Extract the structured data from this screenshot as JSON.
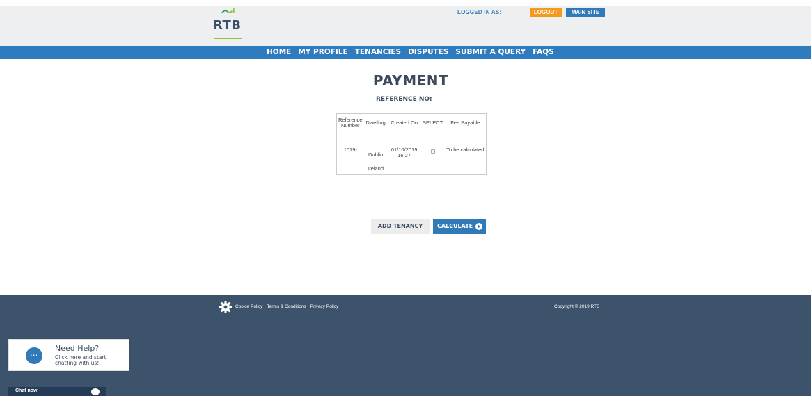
{
  "header": {
    "logo_text": "RTB",
    "logged_in_label": "LOGGED IN AS:",
    "logout_label": "LOGOUT",
    "main_site_label": "MAIN SITE"
  },
  "nav": {
    "items": [
      {
        "label": "HOME"
      },
      {
        "label": "MY PROFILE"
      },
      {
        "label": "TENANCIES"
      },
      {
        "label": "DISPUTES"
      },
      {
        "label": "SUBMIT A QUERY"
      },
      {
        "label": "FAQS"
      }
    ]
  },
  "main": {
    "title": "PAYMENT",
    "reference_label": "REFERENCE NO:",
    "table": {
      "headers": [
        "Reference Number",
        "Dwelling",
        "Created On",
        "SELECT",
        "Fee Payable"
      ],
      "rows": [
        {
          "reference": "1019-",
          "dwelling_line1": "Dublin",
          "dwelling_line2": "Ireland",
          "created_on": "01/10/2019 16:27",
          "select": false,
          "fee": "To be calculated"
        }
      ]
    },
    "add_tenancy_label": "ADD TENANCY",
    "calculate_label": "CALCULATE"
  },
  "footer": {
    "links": [
      "Cookie Policy",
      "Terms & Conditions",
      "Privacy Policy"
    ],
    "copyright": "Copyright © 2019 RTB"
  },
  "chat": {
    "title": "Need Help?",
    "subtitle": "Click here and start chatting with us!",
    "bar_label": "Chat now"
  },
  "colors": {
    "brand_blue": "#2e7cbf",
    "logout_orange": "#f39a1e",
    "footer_navy": "#3d536b",
    "heading_dark": "#3a4a5c"
  }
}
